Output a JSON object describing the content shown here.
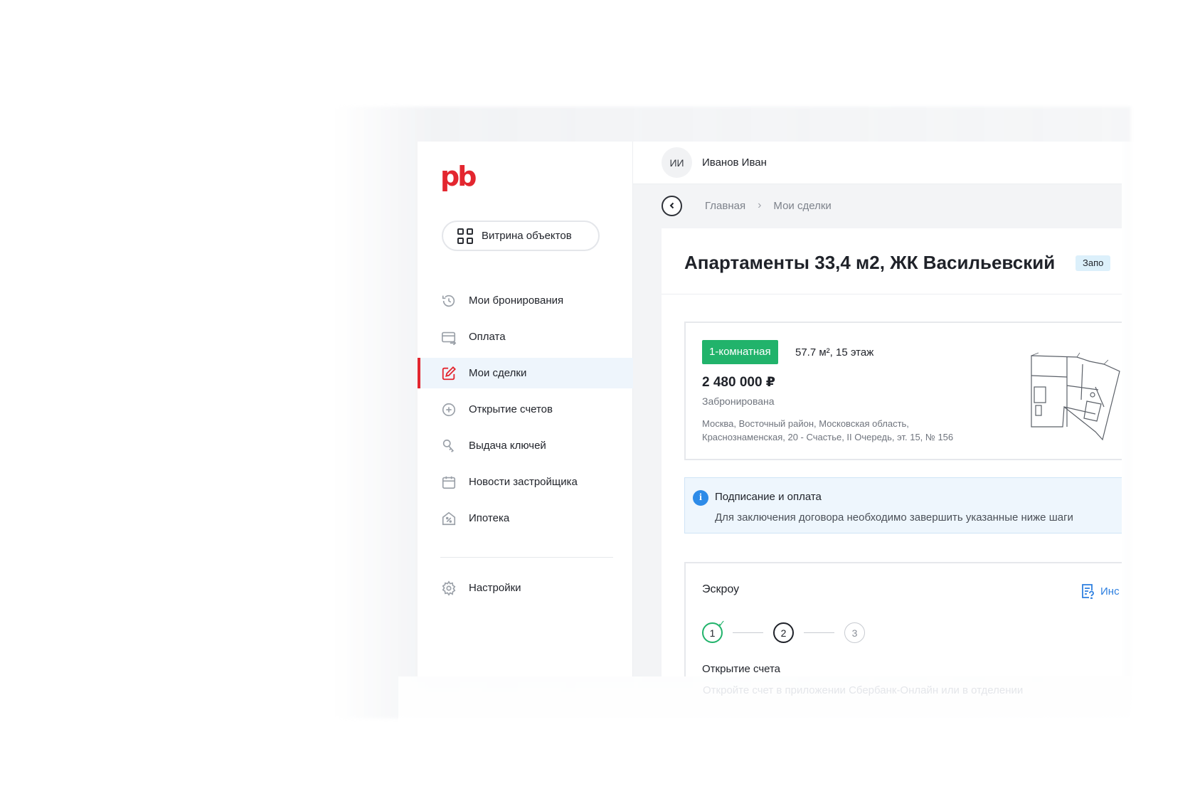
{
  "brand": {
    "logo_text": "pb",
    "accent": "#e3262f"
  },
  "sidebar": {
    "showcase_label": "Витрина объектов",
    "items": [
      {
        "label": "Мои бронирования",
        "icon": "history-icon",
        "active": false
      },
      {
        "label": "Оплата",
        "icon": "card-icon",
        "active": false
      },
      {
        "label": "Мои сделки",
        "icon": "edit-icon",
        "active": true
      },
      {
        "label": "Открытие счетов",
        "icon": "plus-circle-icon",
        "active": false
      },
      {
        "label": "Выдача ключей",
        "icon": "key-icon",
        "active": false
      },
      {
        "label": "Новости застройщика",
        "icon": "calendar-icon",
        "active": false
      },
      {
        "label": "Ипотека",
        "icon": "house-percent-icon",
        "active": false
      }
    ],
    "settings_label": "Настройки"
  },
  "topbar": {
    "avatar_initials": "ИИ",
    "user_name": "Иванов Иван"
  },
  "breadcrumbs": [
    "Главная",
    "Мои сделки"
  ],
  "page": {
    "title": "Апартаменты 33,4 м2, ЖК Васильевский",
    "status_chip": "Запо"
  },
  "object": {
    "rooms_badge": "1-комнатная",
    "area_floor": "57.7 м², 15 этаж",
    "price": "2 480 000 ₽",
    "status": "Забронирована",
    "address_line1": "Москва, Восточный район, Московская область,",
    "address_line2": "Краснознаменская, 20 - Счастье, II Очередь, эт. 15, № 156"
  },
  "info": {
    "title": "Подписание и оплата",
    "text": "Для заключения договора необходимо завершить указанные ниже шаги"
  },
  "escrow": {
    "title": "Эскроу",
    "instructions_label": "Инс",
    "steps": [
      "1",
      "2",
      "3"
    ],
    "current_step_title": "Открытие счета",
    "next_text": "Откройте счет в приложении Сбербанк-Онлайн или в отделении"
  },
  "colors": {
    "accent": "#e3262f",
    "success": "#21b36b",
    "link": "#2d7fe0",
    "info_bg": "#eef6fd",
    "active_bg": "#eef5fc"
  }
}
